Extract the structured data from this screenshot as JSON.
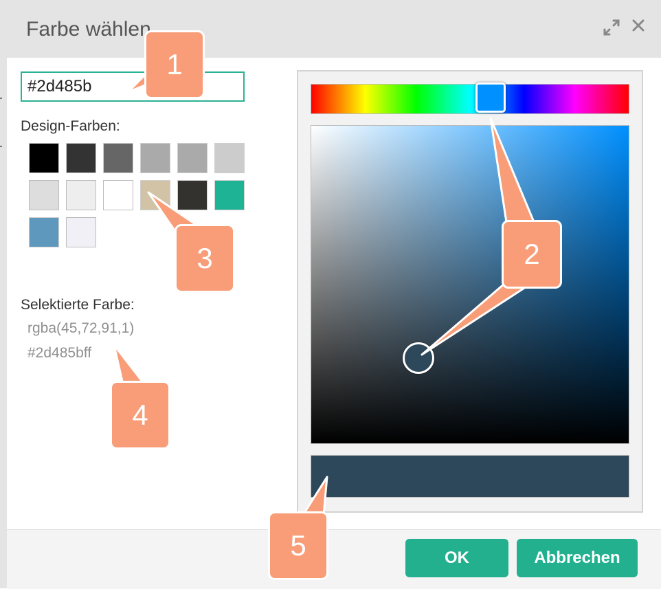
{
  "dialog": {
    "title": "Farbe wählen",
    "expand_icon": "expand-arrows-icon",
    "close_icon": "close-icon"
  },
  "hex_input": {
    "value": "#2d485b"
  },
  "design_colors": {
    "label": "Design-Farben:",
    "swatches": [
      "#000000",
      "#333333",
      "#666666",
      "#aaaaaa",
      "#aaaaaa",
      "#cccccc",
      "#dddddd",
      "#eeeeee",
      "#ffffff",
      "#d3c3a6",
      "#33322f",
      "#1db394",
      "#5f98bd",
      "#f1f0f7"
    ]
  },
  "selected_color": {
    "label": "Selektierte Farbe:",
    "rgba": "rgba(45,72,91,1)",
    "hex": "#2d485b"
  },
  "picker": {
    "hue_color": "#0090ff",
    "preview_color": "#2d485b"
  },
  "buttons": {
    "ok": "OK",
    "cancel": "Abbrechen"
  },
  "callouts": [
    "1",
    "2",
    "3",
    "4",
    "5"
  ],
  "colors": {
    "accent": "#22b08f",
    "callout": "#f89d77"
  }
}
